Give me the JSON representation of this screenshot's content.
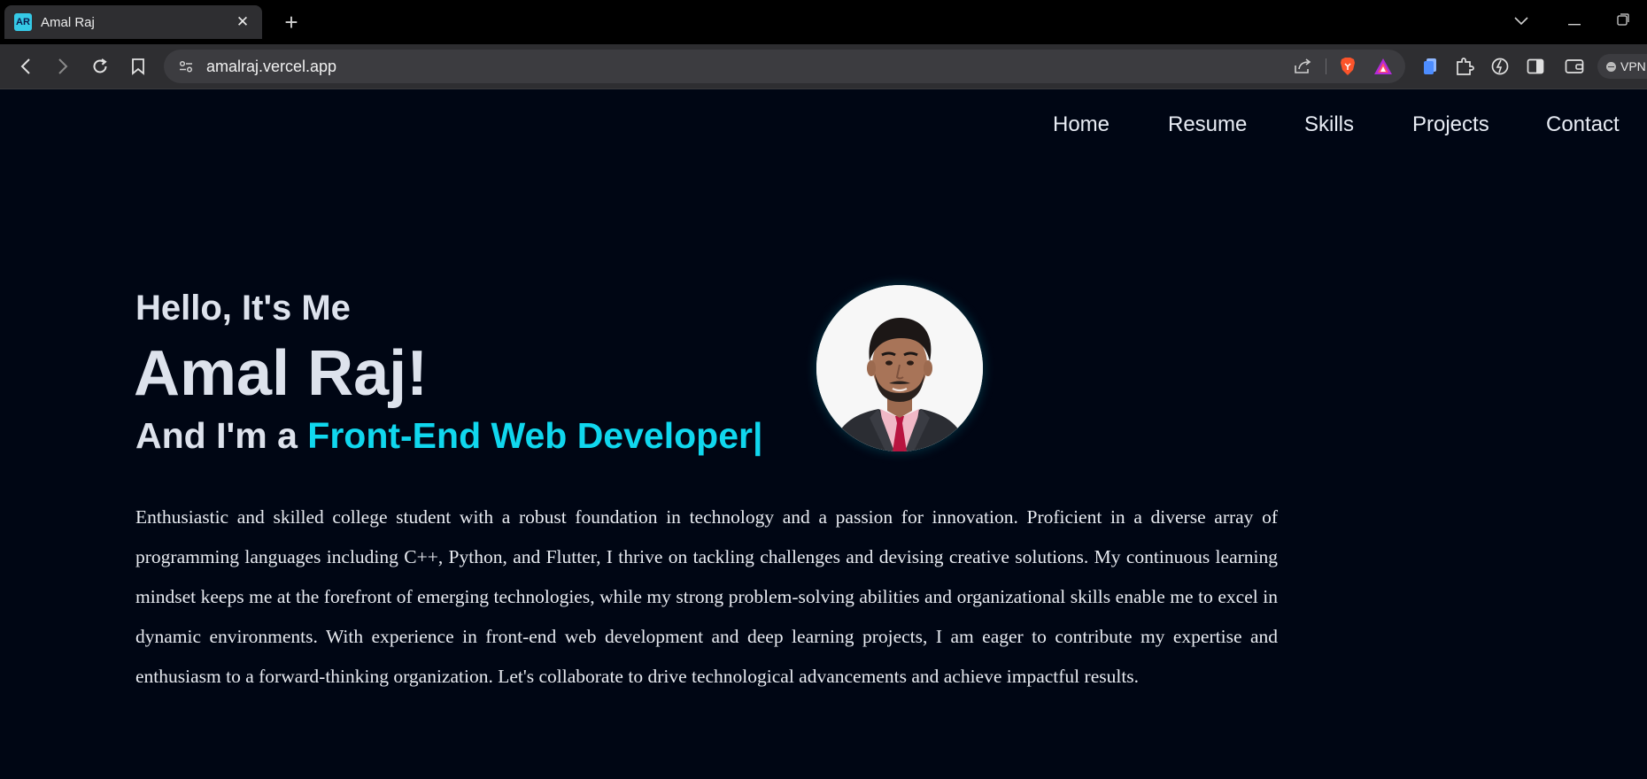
{
  "browser": {
    "tab_title": "Amal Raj",
    "tab_favicon_text": "AR",
    "url": "amalraj.vercel.app",
    "vpn_label": "VPN"
  },
  "nav": {
    "items": [
      {
        "label": "Home"
      },
      {
        "label": "Resume"
      },
      {
        "label": "Skills"
      },
      {
        "label": "Projects"
      },
      {
        "label": "Contact"
      }
    ]
  },
  "hero": {
    "greeting": "Hello, It's Me",
    "name": "Amal Raj!",
    "role_prefix": "And I'm a ",
    "role": "Front-End Web Developer",
    "cursor": "|",
    "bio": "Enthusiastic and skilled college student with a robust foundation in technology and a passion for innovation. Proficient in a diverse array of programming languages including C++, Python, and Flutter, I thrive on tackling challenges and devising creative solutions. My continuous learning mindset keeps me at the forefront of emerging technologies, while my strong problem-solving abilities and organizational skills enable me to excel in dynamic environments. With experience in front-end web development and deep learning projects, I am eager to contribute my expertise and enthusiasm to a forward-thinking organization. Let's collaborate to drive technological advancements and achieve impactful results."
  },
  "colors": {
    "page_background": "#000614",
    "accent": "#10d7ee",
    "text": "#dde2ec"
  }
}
